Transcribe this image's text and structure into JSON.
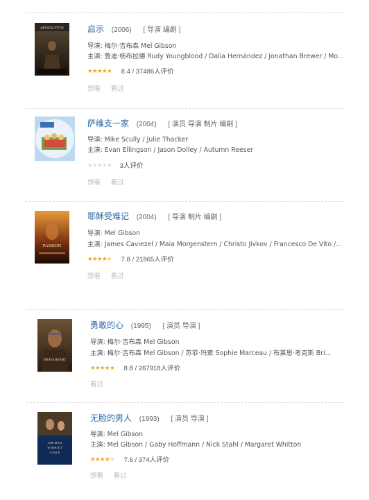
{
  "movies": [
    {
      "title": "启示",
      "year": "(2006)",
      "roles": "[ 导演 编剧 ]",
      "director": "导演: 梅尔·吉布森 Mel Gibson",
      "cast": "主演: 鲁迪·杨布拉德 Rudy Youngblood / Dalia Hernández / Jonathan Brewer / Mo...",
      "score": 0.84,
      "rating_text": "8.4  /  37486人评价",
      "actions": [
        "想看",
        "看过"
      ]
    },
    {
      "title": "萨维支一家",
      "year": "(2004)",
      "roles": "[ 演员 导演 制片 编剧 ]",
      "director": "导演: Mike Scully / Julie Thacker",
      "cast": "主演: Evan Ellingson / Jason Dolley / Autumn Reeser",
      "score": 0,
      "rating_text": "3人评价",
      "actions": [
        "想看",
        "看过"
      ]
    },
    {
      "title": "耶稣受难记",
      "year": "(2004)",
      "roles": "[ 导演 制片 编剧 ]",
      "director": "导演: Mel Gibson",
      "cast": "主演: James Caviezel / Maia Morgenstern / Christo Jivkov / Francesco De Vito /...",
      "score": 0.78,
      "rating_text": "7.8  /  21865人评价",
      "actions": [
        "想看",
        "看过"
      ]
    },
    {
      "title": "勇敢的心",
      "year": "(1995)",
      "roles": "[ 演员 导演 ]",
      "director": "导演: 梅尔·吉布森 Mel Gibson",
      "cast": "主演: 梅尔·吉布森 Mel Gibson / 苏菲·玛索 Sophie Marceau / 布莱恩·考克斯 Bri...",
      "score": 0.88,
      "rating_text": "8.8  /  267918人评价",
      "actions": [
        "看过"
      ]
    },
    {
      "title": "无脸的男人",
      "year": "(1993)",
      "roles": "[ 演员 导演 ]",
      "director": "导演: Mel Gibson",
      "cast": "主演: Mel Gibson / Gaby Hoffmann / Nick Stahl / Margaret Whitton",
      "score": 0.76,
      "rating_text": "7.6  /  374人评价",
      "actions": [
        "想看",
        "看过"
      ]
    }
  ],
  "colors": {
    "title": "#2d6aa3",
    "star": "#f6a623",
    "star_empty": "#dcdcdc"
  }
}
